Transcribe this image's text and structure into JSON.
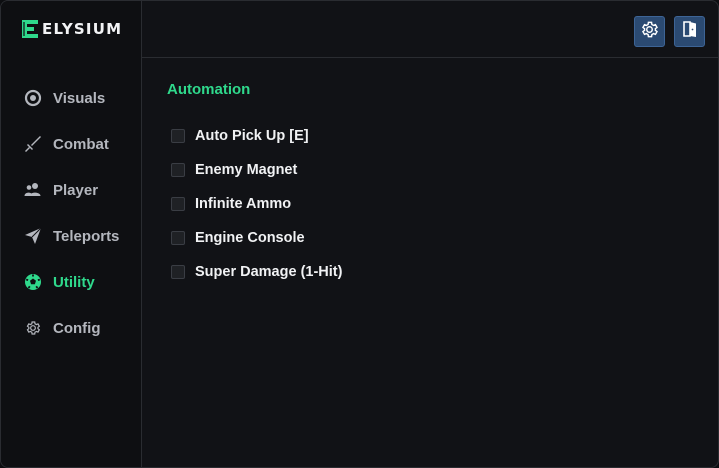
{
  "app": {
    "name": "ELYSIUM"
  },
  "sidebar": {
    "items": [
      {
        "label": "Visuals",
        "icon": "eye-icon",
        "active": false
      },
      {
        "label": "Combat",
        "icon": "sword-icon",
        "active": false
      },
      {
        "label": "Player",
        "icon": "users-icon",
        "active": false
      },
      {
        "label": "Teleports",
        "icon": "paper-plane-icon",
        "active": false
      },
      {
        "label": "Utility",
        "icon": "soccer-ball-icon",
        "active": true
      },
      {
        "label": "Config",
        "icon": "gear-icon",
        "active": false
      }
    ]
  },
  "topbar": {
    "buttons": [
      {
        "icon": "gear-icon"
      },
      {
        "icon": "exit-door-icon"
      }
    ]
  },
  "main": {
    "section_title": "Automation",
    "options": [
      {
        "label": "Auto Pick Up [E]",
        "checked": false
      },
      {
        "label": "Enemy Magnet",
        "checked": false
      },
      {
        "label": "Infinite Ammo",
        "checked": false
      },
      {
        "label": "Engine Console",
        "checked": false
      },
      {
        "label": "Super Damage (1-Hit)",
        "checked": false
      }
    ]
  },
  "colors": {
    "accent": "#2fd98c",
    "button_bg": "#2b4a72",
    "background": "#111216"
  }
}
